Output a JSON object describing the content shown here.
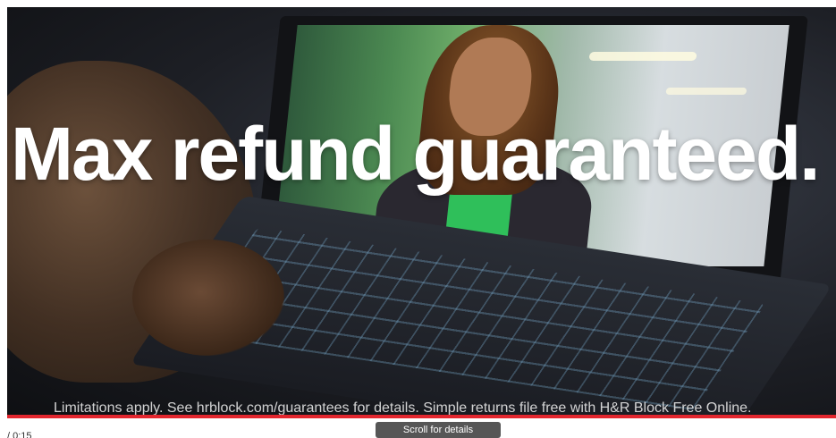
{
  "video": {
    "headline": "Max refund guaranteed.",
    "disclaimer": "Limitations apply. See hrblock.com/guarantees for details. Simple returns file free with H&R Block Free Online.",
    "time_text": "/ 0:15",
    "scroll_hint": "Scroll for details",
    "progress_fraction": 1.0
  },
  "colors": {
    "progress": "#e3262e"
  }
}
